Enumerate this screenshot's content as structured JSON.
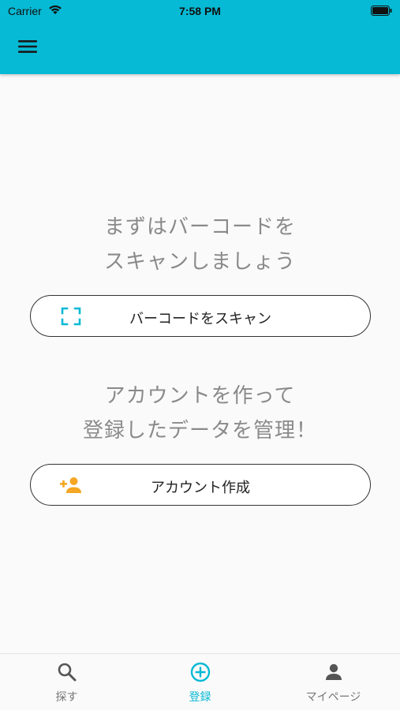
{
  "status_bar": {
    "carrier": "Carrier",
    "time": "7:58 PM"
  },
  "app_bar": {
    "menu_icon": "hamburger-menu-icon",
    "background_color": "#06b9d4"
  },
  "main": {
    "scan_prompt_line1": "まずはバーコードを",
    "scan_prompt_line2": "スキャンしましょう",
    "scan_button_label": "バーコードをスキャン",
    "scan_button_icon": "barcode-scan-frame-icon",
    "account_prompt_line1": "アカウントを作って",
    "account_prompt_line2": "登録したデータを管理！",
    "account_button_label": "アカウント作成",
    "account_button_icon": "add-person-icon"
  },
  "bottom_nav": {
    "items": [
      {
        "label": "探す",
        "icon": "search-icon",
        "active": false
      },
      {
        "label": "登録",
        "icon": "add-circle-icon",
        "active": true
      },
      {
        "label": "マイページ",
        "icon": "person-icon",
        "active": false
      }
    ]
  },
  "colors": {
    "accent": "#06b9d4",
    "secondary_accent": "#f5a623",
    "prompt_text": "#8a8a8a"
  }
}
